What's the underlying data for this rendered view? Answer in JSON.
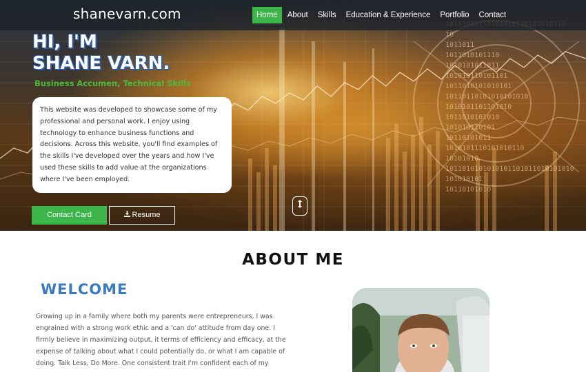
{
  "brand": "shanevarn.com",
  "nav": [
    {
      "label": "Home",
      "active": true
    },
    {
      "label": "About",
      "active": false
    },
    {
      "label": "Skills",
      "active": false
    },
    {
      "label": "Education & Experience",
      "active": false
    },
    {
      "label": "Portfolio",
      "active": false
    },
    {
      "label": "Contact",
      "active": false
    }
  ],
  "hero": {
    "title_line1": "HI, I'M",
    "title_line2": "SHANE VARN.",
    "subtitle": "Business Accumen, Technical Skills",
    "intro": "This website was developed to showcase some of my professional and personal work. I enjoy using technology to enhance business functions and decisions. Across this website, you'll find examples of the skills I've developed over the years and how I've used these skills to add value at the organizations where I've been employed.",
    "contact_button": "Contact Card",
    "resume_button": "Resume",
    "binary_lines": [
      "10101010110101010110101010110",
      "10",
      "1011011",
      "1011010101110",
      "1010101011011",
      "101010110101101",
      "1011010101010101",
      "10110110101010101010",
      "1010101101101010",
      "1011010101010",
      "101010110101",
      "10110101011",
      "1010101110101010110",
      "10101010",
      "1011010101010101101011010101010",
      "101010101",
      "10110101010"
    ]
  },
  "about": {
    "heading": "ABOUT ME",
    "welcome": "WELCOME",
    "text": "Growing up in a family where both my parents were entrepreneurs, I was engrained with a strong work ethic and a 'can do' attitude from day one. I firmly believe in maximizing output, it terms of efficiency and efficacy, at the expense of talking about what I could potentially do, or what I am capable of doing. Talk Less, Do More. One consistent trait I'm confident each of my"
  },
  "colors": {
    "accent_green": "#3cb54a",
    "subtitle_green": "#4cbb3c",
    "welcome_blue": "#3b7abf",
    "navbar": "#1c2128"
  },
  "icons": {
    "resume": "download-icon",
    "scroll": "scroll-down-icon"
  }
}
